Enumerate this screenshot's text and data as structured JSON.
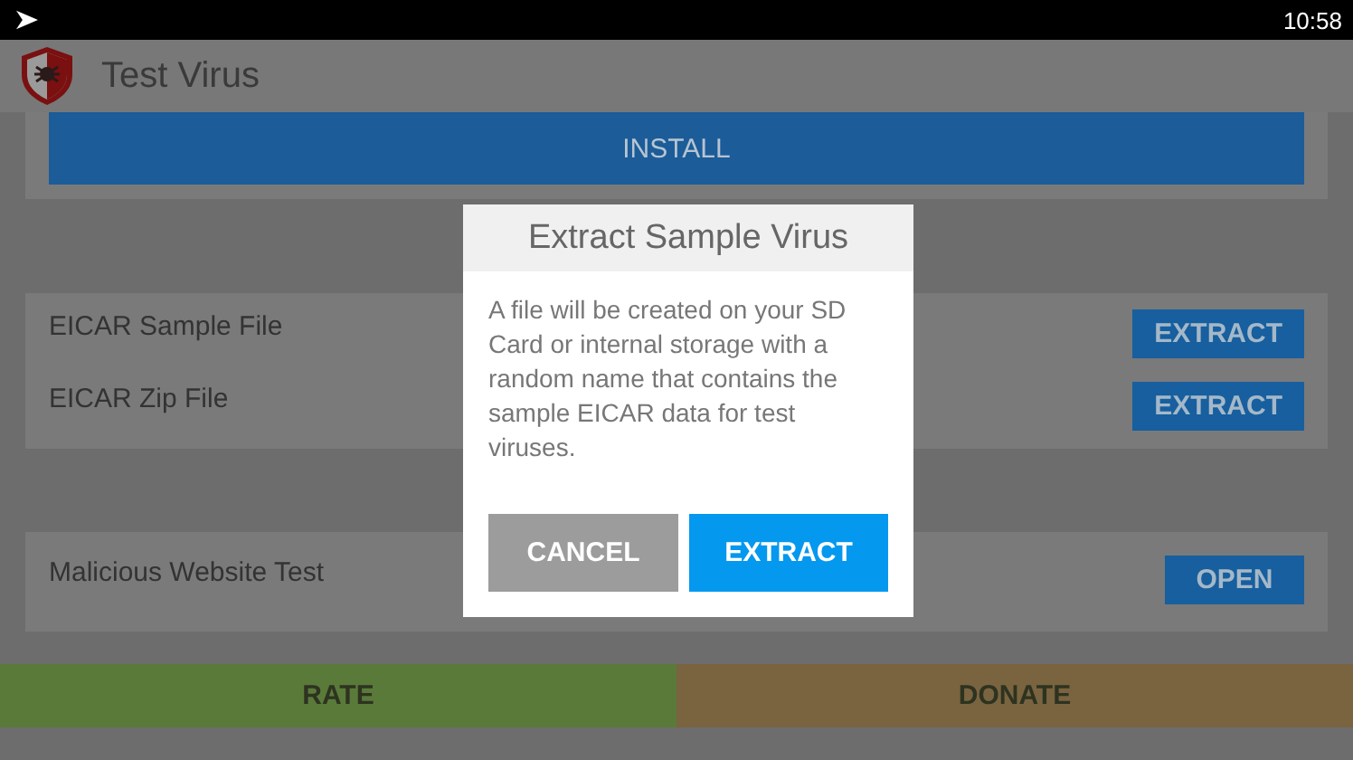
{
  "status_bar": {
    "time": "10:58"
  },
  "app_bar": {
    "title": "Test Virus"
  },
  "install_button": {
    "label": "INSTALL"
  },
  "sample_items": [
    {
      "label": "EICAR Sample File",
      "button": "EXTRACT"
    },
    {
      "label": "EICAR Zip File",
      "button": "EXTRACT"
    }
  ],
  "web_items": [
    {
      "label": "Malicious Website Test",
      "button": "OPEN"
    }
  ],
  "bottom_buttons": [
    {
      "label": "RATE",
      "color": "#5a7a3a"
    },
    {
      "label": "DONATE",
      "color": "#7a6440"
    }
  ],
  "dialog": {
    "title": "Extract Sample Virus",
    "message": "A file will be created on your SD Card or internal storage with a random name that contains the sample EICAR data for test viruses.",
    "buttons": [
      {
        "label": "CANCEL",
        "kind": "neutral"
      },
      {
        "label": "EXTRACT",
        "kind": "primary"
      }
    ]
  }
}
